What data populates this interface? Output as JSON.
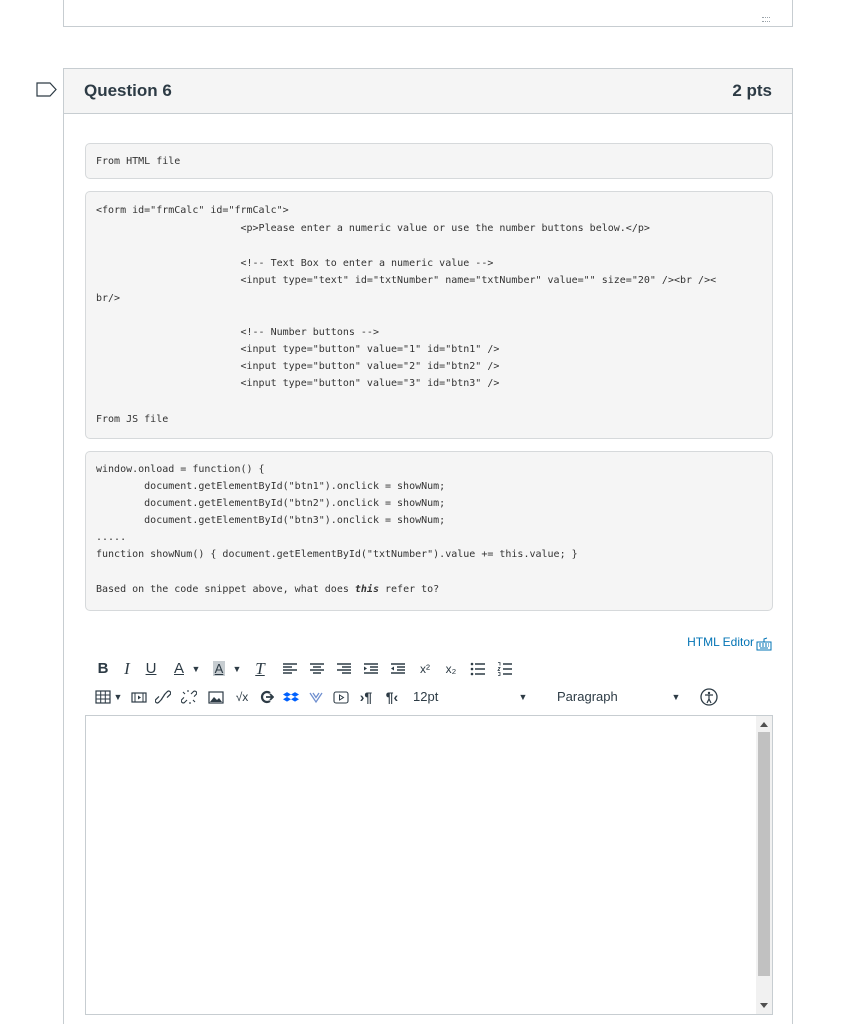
{
  "question": {
    "title": "Question 6",
    "points": "2 pts",
    "label_html": "From HTML file",
    "code_html": [
      "<form id=\"frmCalc\" id=\"frmCalc\">",
      "                        <p>Please enter a numeric value or use the number buttons below.</p>",
      "",
      "                        <!-- Text Box to enter a numeric value -->",
      "                        <input type=\"text\" id=\"txtNumber\" name=\"txtNumber\" value=\"\" size=\"20\" /><br /><",
      "br/>",
      "",
      "                        <!-- Number buttons -->",
      "                        <input type=\"button\" value=\"1\" id=\"btn1\" />",
      "                        <input type=\"button\" value=\"2\" id=\"btn2\" />",
      "                        <input type=\"button\" value=\"3\" id=\"btn3\" />",
      "",
      "From JS file"
    ],
    "code_js": [
      "window.onload = function() {",
      "        document.getElementById(\"btn1\").onclick = showNum;",
      "        document.getElementById(\"btn2\").onclick = showNum;",
      "        document.getElementById(\"btn3\").onclick = showNum;",
      ".....",
      "function showNum() { document.getElementById(\"txtNumber\").value += this.value; }",
      ""
    ],
    "prompt_before": "Based on the code snippet above, what does ",
    "prompt_keyword": "this",
    "prompt_after": " refer to?"
  },
  "editor": {
    "html_editor_label": "HTML Editor",
    "bold": "B",
    "italic": "I",
    "underline": "U",
    "text_color": "A",
    "bg_color": "A",
    "clear_format": "T",
    "superscript": "x²",
    "subscript": "x₂",
    "font_size": "12pt",
    "block_format": "Paragraph"
  },
  "colors": {
    "link": "#0374b5",
    "text": "#2d3b45",
    "border": "#c7cdd1"
  }
}
